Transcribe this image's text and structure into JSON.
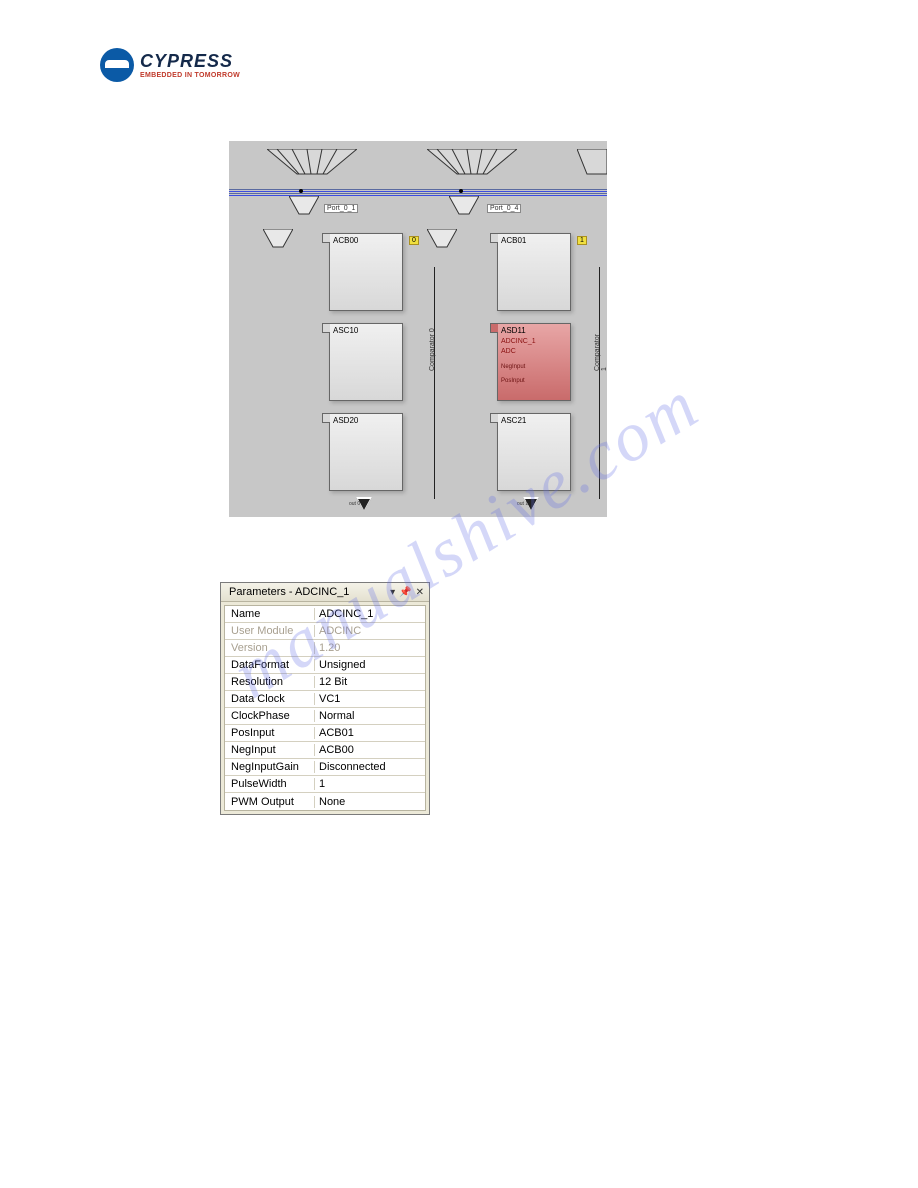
{
  "logo": {
    "brand": "CYPRESS",
    "tagline": "EMBEDDED IN TOMORROW"
  },
  "canvas": {
    "port0_1": "Port_0_1",
    "port0_4": "Port_0_4",
    "marker0": "0",
    "marker1": "1",
    "comparator0": "Comparator 0",
    "comparator1": "Comparator 1",
    "blocks": {
      "acb00": "ACB00",
      "acb01": "ACB01",
      "asc10": "ASC10",
      "asd11": "ASD11",
      "asd20": "ASD20",
      "asc21": "ASC21"
    },
    "adc": {
      "name": "ADCINC_1",
      "sub": "ADC",
      "neg": "NegInput",
      "pos": "PosInput"
    },
    "out0": "out 0",
    "out1": "out 1"
  },
  "panel": {
    "title": "Parameters - ADCINC_1",
    "rows": [
      {
        "k": "Name",
        "v": "ADCINC_1",
        "faded": false
      },
      {
        "k": "User Module",
        "v": "ADCINC",
        "faded": true
      },
      {
        "k": "Version",
        "v": "1.20",
        "faded": true
      },
      {
        "k": "DataFormat",
        "v": "Unsigned",
        "faded": false
      },
      {
        "k": "Resolution",
        "v": "12 Bit",
        "faded": false
      },
      {
        "k": "Data Clock",
        "v": "VC1",
        "faded": false
      },
      {
        "k": "ClockPhase",
        "v": "Normal",
        "faded": false
      },
      {
        "k": "PosInput",
        "v": "ACB01",
        "faded": false
      },
      {
        "k": "NegInput",
        "v": "ACB00",
        "faded": false
      },
      {
        "k": "NegInputGain",
        "v": "Disconnected",
        "faded": false
      },
      {
        "k": "PulseWidth",
        "v": "1",
        "faded": false
      },
      {
        "k": "PWM Output",
        "v": "None",
        "faded": false
      }
    ]
  },
  "watermark": "manualshive.com"
}
